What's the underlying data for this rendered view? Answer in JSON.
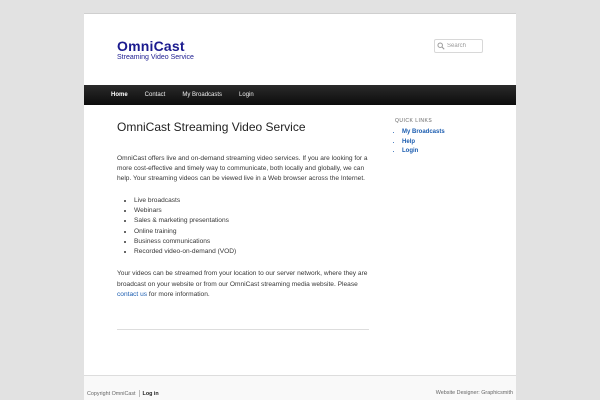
{
  "site": {
    "title": "OmniCast",
    "description": "Streaming Video Service"
  },
  "search": {
    "placeholder": "Search"
  },
  "nav": {
    "items": [
      {
        "label": "Home",
        "current": true
      },
      {
        "label": "Contact"
      },
      {
        "label": "My Broadcasts"
      },
      {
        "label": "Login"
      }
    ]
  },
  "main": {
    "title": "OmniCast Streaming Video Service",
    "intro": "OmniCast offers live and on-demand streaming video services. If you are looking for a more cost-effective and timely way to communicate, both locally and globally, we can help. Your streaming videos can be viewed live in a Web browser across the Internet.",
    "list": [
      "Live broadcasts",
      "Webinars",
      "Sales & marketing presentations",
      "Online training",
      "Business communications",
      "Recorded video-on-demand (VOD)"
    ],
    "outro_before": "Your videos can be streamed from your location to our server network, where they are broadcast on your website or from our OmniCast streaming media website. Please ",
    "outro_link": "contact us",
    "outro_after": " for more information."
  },
  "sidebar": {
    "widget_title": "QUICK LINKS",
    "links": [
      "My Broadcasts",
      "Help",
      "Login"
    ]
  },
  "footer": {
    "copyright": "Copyright OmniCast",
    "login": "Log in",
    "designer": "Website Designer: Graphicsmith"
  },
  "colors": {
    "title": "#1b1b8f",
    "link": "#1b5db0",
    "nav_bg": "#1a1a1a"
  }
}
